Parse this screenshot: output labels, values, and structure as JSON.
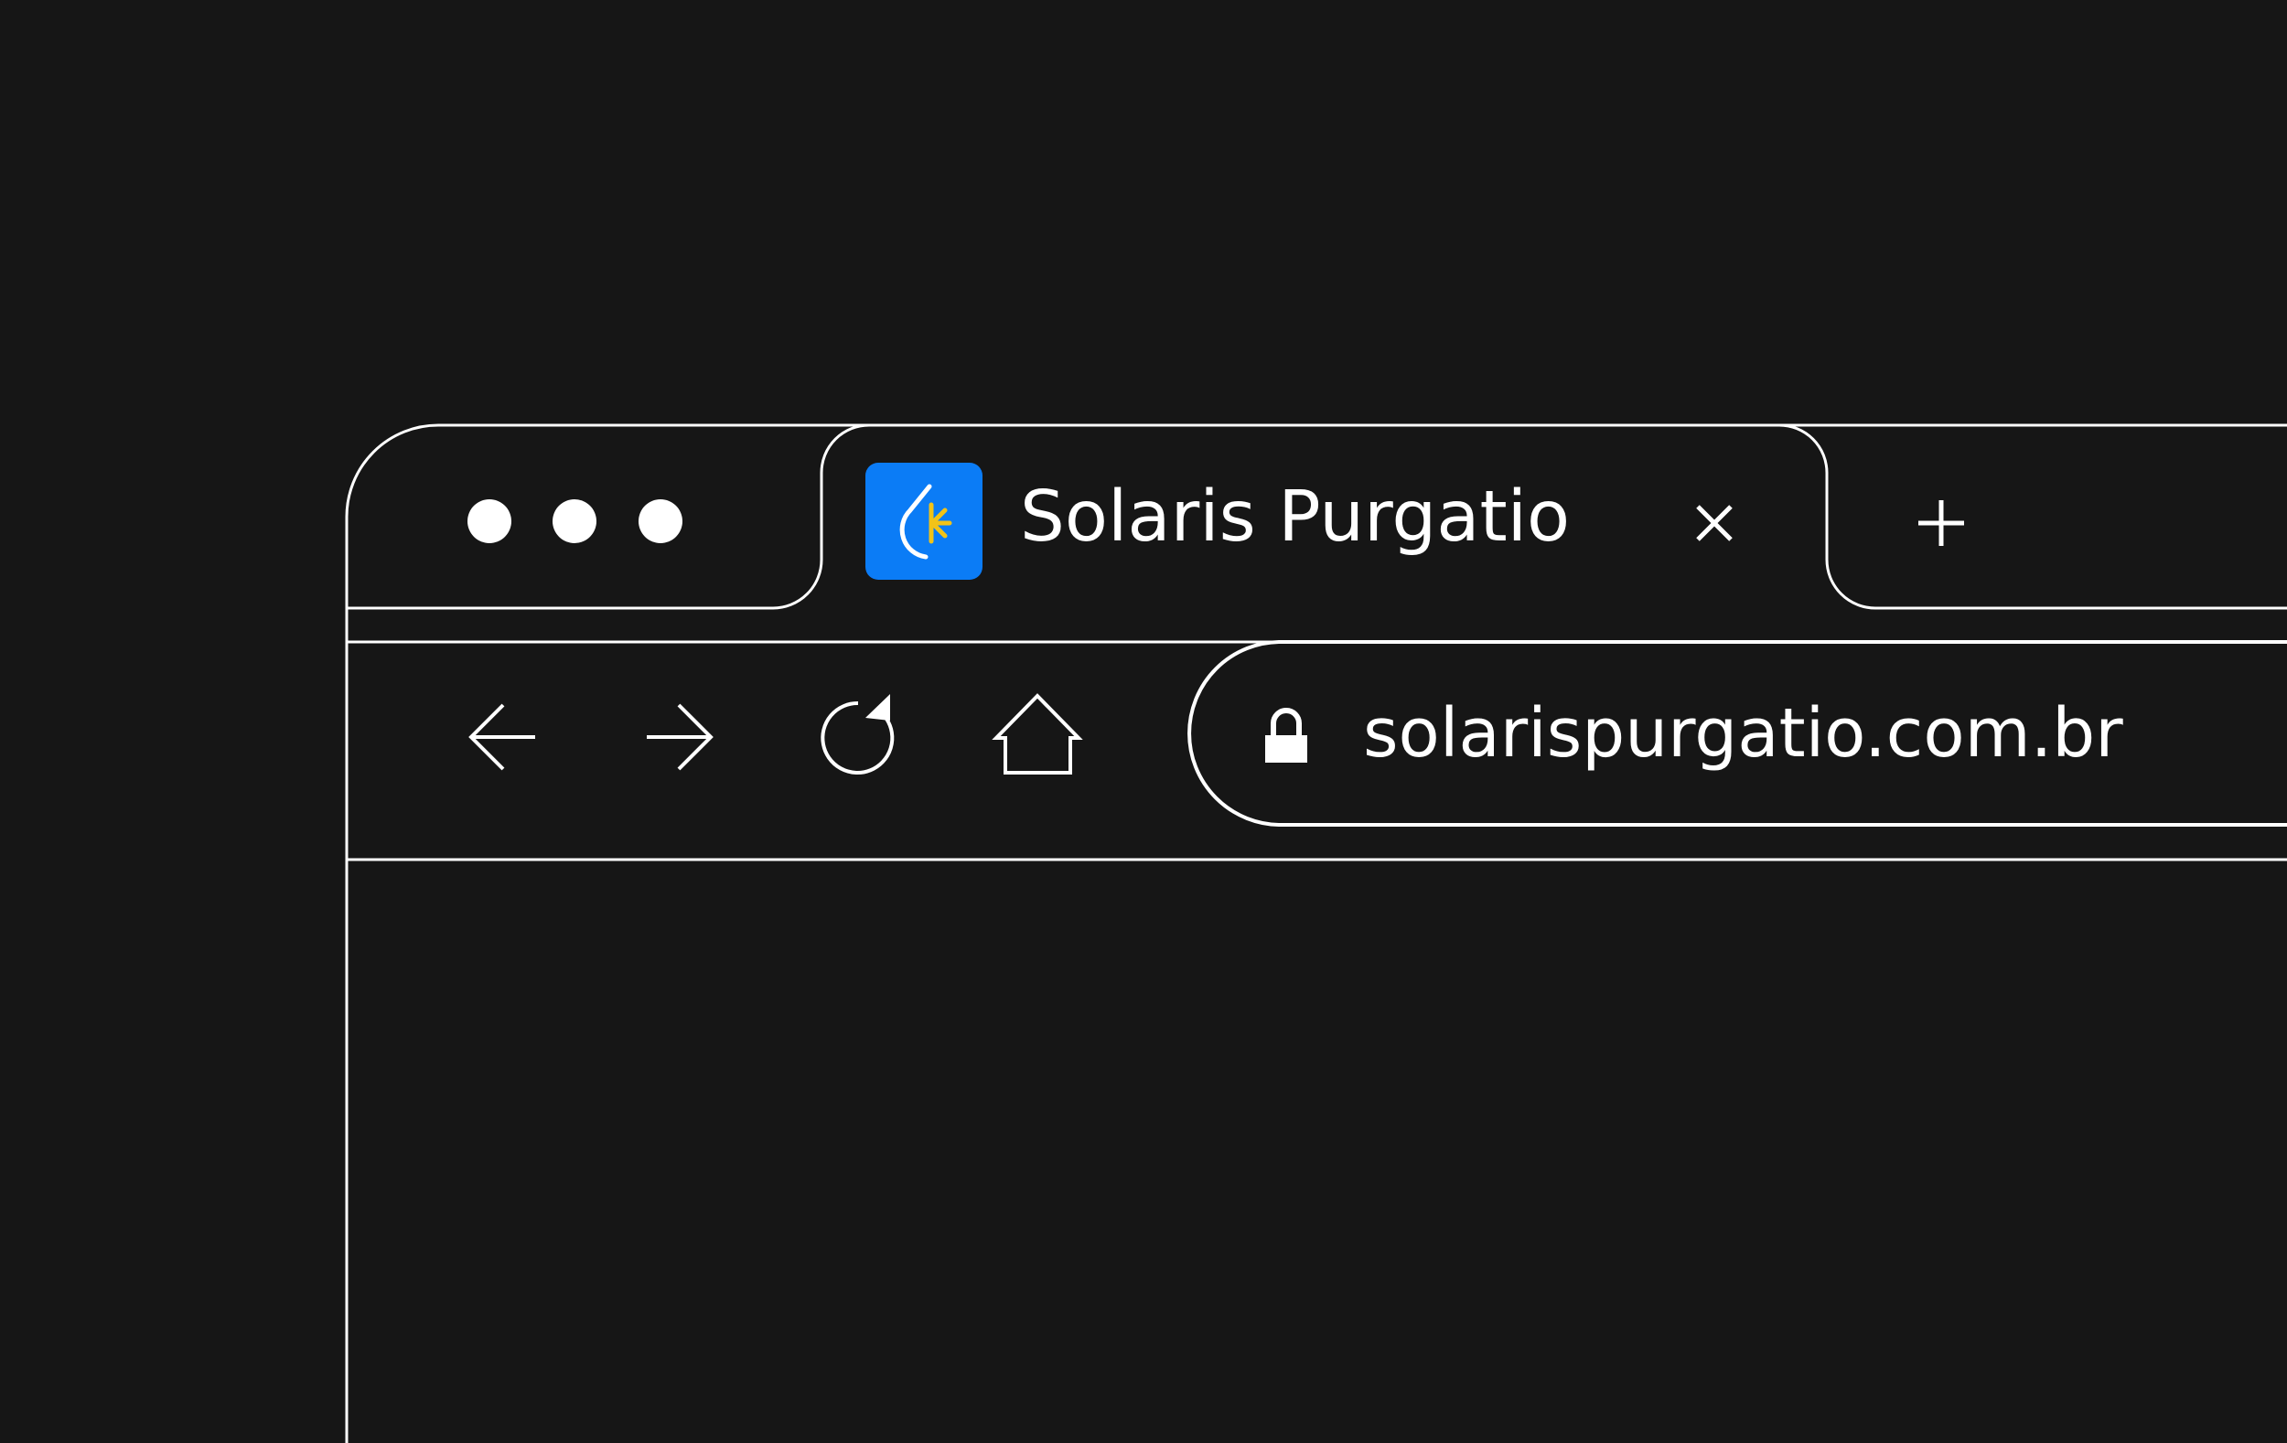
{
  "window": {
    "controls": [
      "close-dot",
      "minimize-dot",
      "maximize-dot"
    ]
  },
  "tab": {
    "title": "Solaris Purgatio",
    "favicon": "solaris-logo-icon",
    "close_icon": "close-icon"
  },
  "new_tab": {
    "icon": "plus-icon"
  },
  "toolbar": {
    "back_icon": "arrow-left-icon",
    "forward_icon": "arrow-right-icon",
    "reload_icon": "reload-icon",
    "home_icon": "home-icon"
  },
  "address_bar": {
    "lock_icon": "lock-icon",
    "url": "solarispurgatio.com.br"
  },
  "colors": {
    "background": "#161616",
    "stroke": "#ffffff",
    "favicon_bg": "#0b7cf6",
    "favicon_accent": "#f2c318"
  }
}
